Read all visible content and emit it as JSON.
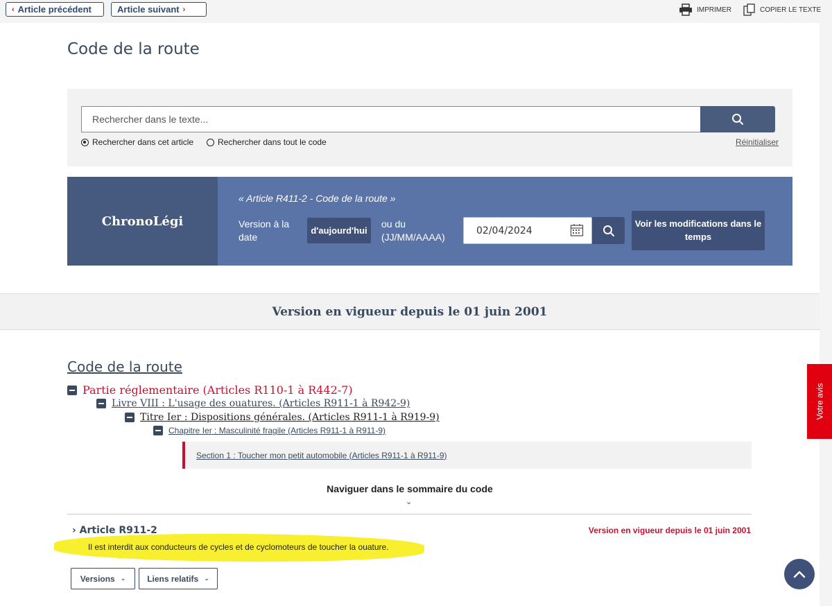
{
  "toolbar": {
    "prev_label": "Article précédent",
    "next_label": "Article suivant",
    "print_label": "IMPRIMER",
    "copy_label": "COPIER LE TEXTE"
  },
  "page": {
    "title": "Code de la route"
  },
  "search": {
    "placeholder": "Rechercher dans le texte...",
    "option_article": "Rechercher dans cet article",
    "option_code": "Rechercher dans tout le code",
    "selected_option": "option_article",
    "reset_label": "Réinitialiser"
  },
  "chrono": {
    "title": "ChronoLégi",
    "article": "« Article R411-2 - Code de la route »",
    "version_label": "Version à la date",
    "today_label": "d'aujourd'hui",
    "or_label": "ou du (JJ/MM/AAAA)",
    "date_value": "02/04/2024",
    "modif_label": "Voir les modifications dans le temps"
  },
  "version_banner": "Version en vigueur depuis le 01 juin 2001",
  "breadcrumb": {
    "code": "Code de la route",
    "partie": "Partie réglementaire (Articles R110-1 à R442-7)",
    "livre": "Livre VIII : L'usage des ouatures. (Articles R911-1 à R942-9)",
    "titre": "Titre Ier : Dispositions générales. (Articles R911-1 à R919-9)",
    "chapitre": "Chapitre Ier : Masculinité fragile (Articles R911-1 à R911-9)",
    "section": "Section 1 : Toucher mon petit automobile (Articles R911-1 à R911-9)"
  },
  "navigate_summary": "Naviguer dans le sommaire du code",
  "article": {
    "title": "Article R911-2",
    "version": "Version en vigueur depuis le 01 juin 2001",
    "text": "Il est interdit aux conducteurs de cycles et de cyclomoteurs de toucher la ouature."
  },
  "buttons": {
    "versions": "Versions",
    "liens": "Liens relatifs"
  },
  "feedback_tab": "Votre avis",
  "colors": {
    "accent_red": "#c8102e",
    "navy": "#3a4a5e",
    "chrono_blue": "#5a74a8",
    "highlight": "#f7ee1c"
  }
}
